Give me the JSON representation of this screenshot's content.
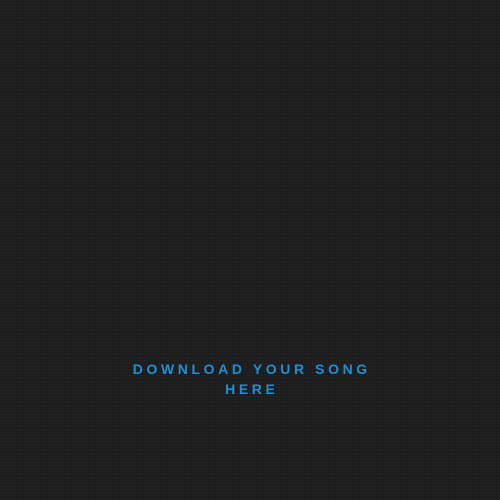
{
  "background_color": "#1c1c1c",
  "accent_color": "#1e90d6",
  "download": {
    "line1": "DOWNLOAD YOUR SONG",
    "line2": "HERE"
  }
}
